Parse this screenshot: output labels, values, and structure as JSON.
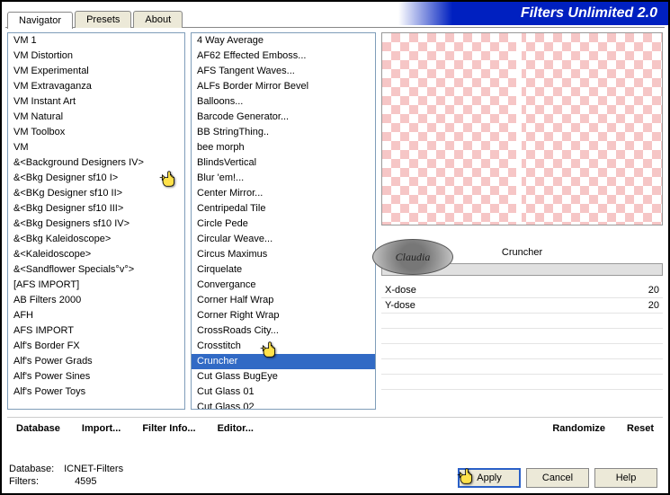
{
  "title": "Filters Unlimited 2.0",
  "tabs": [
    {
      "label": "Navigator",
      "active": true
    },
    {
      "label": "Presets",
      "active": false
    },
    {
      "label": "About",
      "active": false
    }
  ],
  "left_list": [
    "VM 1",
    "VM Distortion",
    "VM Experimental",
    "VM Extravaganza",
    "VM Instant Art",
    "VM Natural",
    "VM Toolbox",
    "VM",
    "&<Background Designers IV>",
    "&<Bkg Designer sf10 I>",
    "&<BKg Designer sf10 II>",
    "&<Bkg Designer sf10 III>",
    "&<Bkg Designers sf10 IV>",
    "&<Bkg Kaleidoscope>",
    "&<Kaleidoscope>",
    "&<Sandflower Specials°v°>",
    "[AFS IMPORT]",
    "AB Filters 2000",
    "AFH",
    "AFS IMPORT",
    "Alf's Border FX",
    "Alf's Power Grads",
    "Alf's Power Sines",
    "Alf's Power Toys"
  ],
  "left_selected_index": 9,
  "mid_list": [
    "4 Way Average",
    "AF62 Effected Emboss...",
    "AFS Tangent Waves...",
    "ALFs Border Mirror Bevel",
    "Balloons...",
    "Barcode Generator...",
    "BB StringThing..",
    "bee morph",
    "BlindsVertical",
    "Blur 'em!...",
    "Center Mirror...",
    "Centripedal Tile",
    "Circle Pede",
    "Circular Weave...",
    "Circus Maximus",
    "Cirquelate",
    "Convergance",
    "Corner Half Wrap",
    "Corner Right Wrap",
    "CrossRoads City...",
    "Crosstitch",
    "Cruncher",
    "Cut Glass  BugEye",
    "Cut Glass 01",
    "Cut Glass 02"
  ],
  "mid_selected_index": 21,
  "filter_name": "Cruncher",
  "params": [
    {
      "name": "X-dose",
      "value": "20"
    },
    {
      "name": "Y-dose",
      "value": "20"
    }
  ],
  "badge_text": "Claudia",
  "toolbar": {
    "database": "Database",
    "import": "Import...",
    "filter_info": "Filter Info...",
    "editor": "Editor...",
    "randomize": "Randomize",
    "reset": "Reset"
  },
  "footer": {
    "db_label": "Database:",
    "db_value": "ICNET-Filters",
    "filters_label": "Filters:",
    "filters_value": "4595"
  },
  "buttons": {
    "apply": "Apply",
    "cancel": "Cancel",
    "help": "Help"
  }
}
